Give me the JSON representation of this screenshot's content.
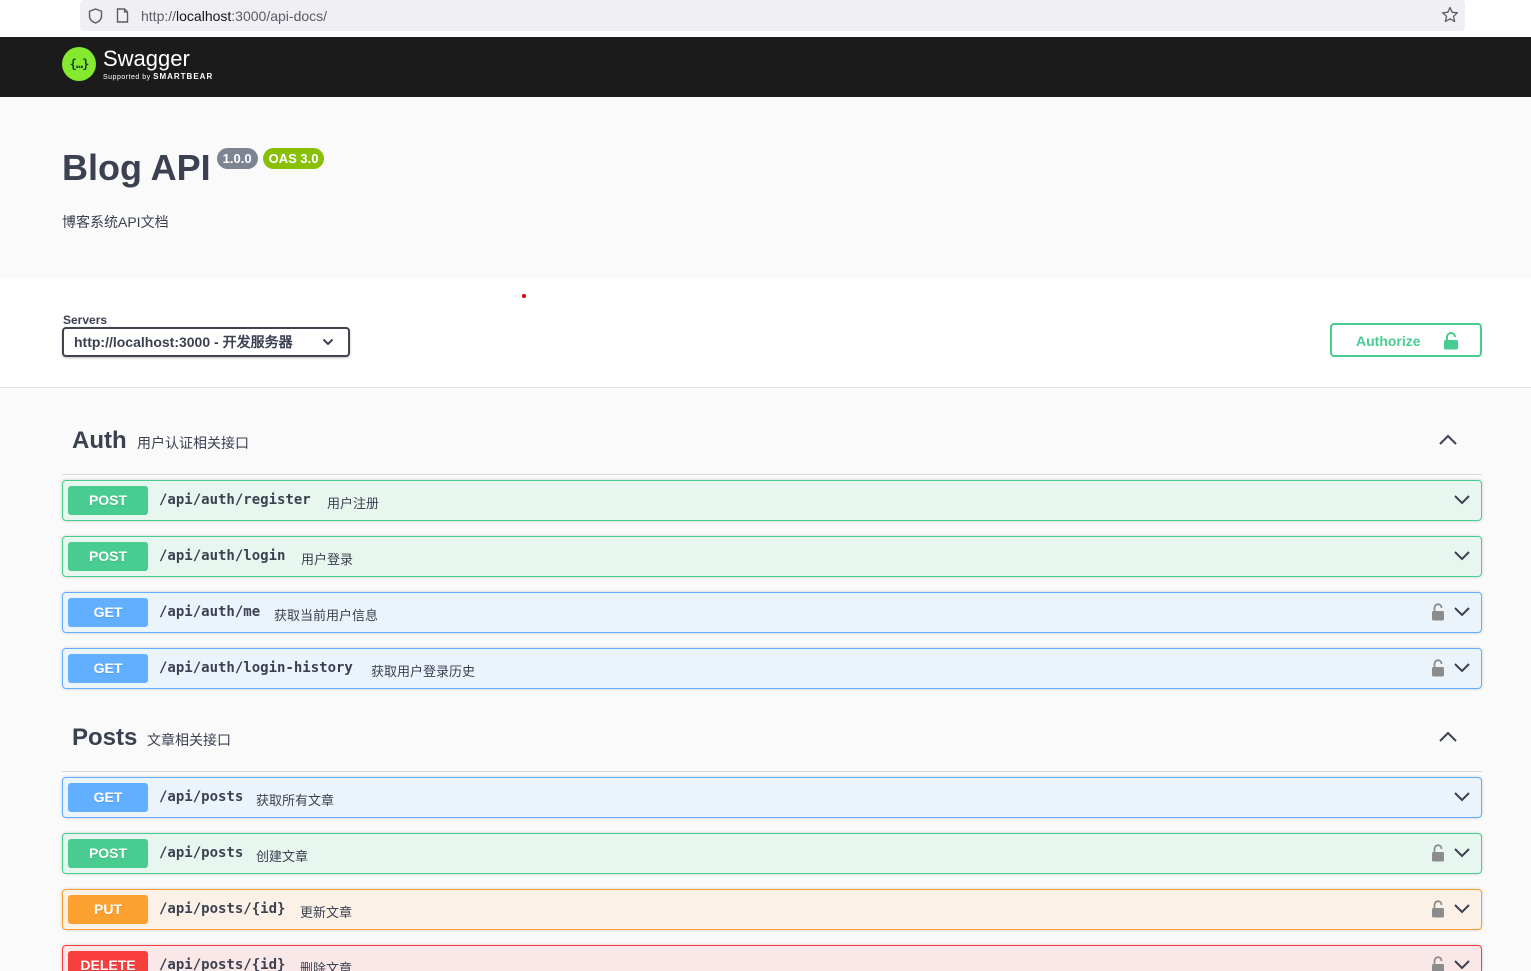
{
  "browser": {
    "url_prefix": "http://",
    "url_host": "localhost",
    "url_rest": ":3000/api-docs/"
  },
  "topbar": {
    "logo_symbol": "{…}",
    "logo_name": "Swagger",
    "logo_supported": "Supported by",
    "logo_brand": "SMARTBEAR"
  },
  "info": {
    "title": "Blog API",
    "version": "1.0.0",
    "oas": "OAS 3.0",
    "description": "博客系统API文档"
  },
  "servers": {
    "label": "Servers",
    "selected": "http://localhost:3000 - 开发服务器"
  },
  "authorize": {
    "label": "Authorize"
  },
  "tags": [
    {
      "name": "Auth",
      "description": "用户认证相关接口"
    },
    {
      "name": "Posts",
      "description": "文章相关接口"
    }
  ],
  "operations": [
    {
      "method": "POST",
      "path": "/api/auth/register",
      "summary": "用户注册",
      "locked": false
    },
    {
      "method": "POST",
      "path": "/api/auth/login",
      "summary": "用户登录",
      "locked": false
    },
    {
      "method": "GET",
      "path": "/api/auth/me",
      "summary": "获取当前用户信息",
      "locked": true
    },
    {
      "method": "GET",
      "path": "/api/auth/login-history",
      "summary": "获取用户登录历史",
      "locked": true
    },
    {
      "method": "GET",
      "path": "/api/posts",
      "summary": "获取所有文章",
      "locked": false
    },
    {
      "method": "POST",
      "path": "/api/posts",
      "summary": "创建文章",
      "locked": true
    },
    {
      "method": "PUT",
      "path": "/api/posts/{id}",
      "summary": "更新文章",
      "locked": true
    },
    {
      "method": "DELETE",
      "path": "/api/posts/{id}",
      "summary": "删除文章",
      "locked": true
    }
  ],
  "colors": {
    "post": "#49cc90",
    "get": "#61affe",
    "put": "#fca130",
    "delete": "#f93e3e",
    "topbar": "#1b1b1b",
    "logo": "#85ea2d"
  }
}
